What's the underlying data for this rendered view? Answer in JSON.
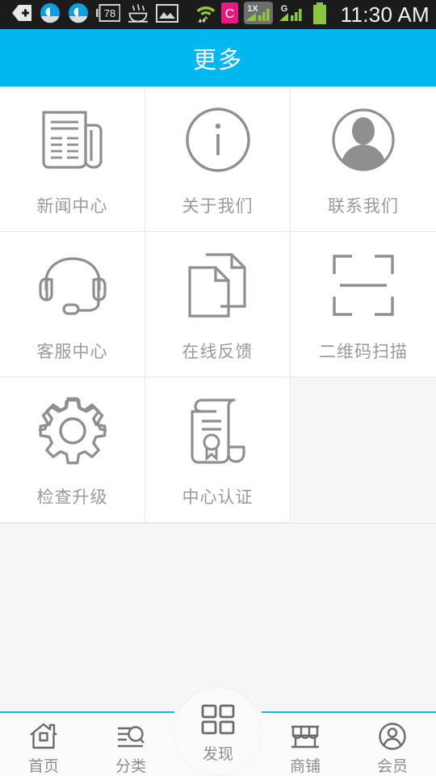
{
  "statusbar": {
    "time": "11:30 AM",
    "left_icons": [
      {
        "name": "back-plus-icon",
        "label": "back-plus"
      },
      {
        "name": "cloud-sync-icon",
        "label": "cloud-sync"
      },
      {
        "name": "cloud-sync-icon-2",
        "label": "cloud-sync"
      },
      {
        "name": "battery-percent-badge-icon",
        "label": "78"
      },
      {
        "name": "steam-bowl-icon",
        "label": "steam-bowl"
      },
      {
        "name": "image-icon",
        "label": "image"
      }
    ],
    "right_icons": [
      {
        "name": "wifi-icon",
        "label": "wifi"
      },
      {
        "name": "c-app-icon",
        "label": "C"
      },
      {
        "name": "signal-1x-icon",
        "label": "1X"
      },
      {
        "name": "signal-g-icon",
        "label": "G"
      },
      {
        "name": "battery-icon",
        "label": "battery"
      }
    ],
    "badge_value": "78",
    "c_badge_letter": "C",
    "onex_label": "1X",
    "g_label": "G",
    "colors": {
      "bg": "#1b1b1b",
      "text": "#f2f2f2",
      "signal_green": "#8cc63e",
      "c_pink": "#e5197f",
      "cloud_blue": "#0b9fe0"
    }
  },
  "header": {
    "title": "更多",
    "bg": "#00b7f0",
    "text_color": "#ffffff"
  },
  "grid": {
    "items": [
      {
        "label": "新闻中心",
        "icon": "newspaper-icon"
      },
      {
        "label": "关于我们",
        "icon": "info-circle-icon"
      },
      {
        "label": "联系我们",
        "icon": "person-avatar-icon"
      },
      {
        "label": "客服中心",
        "icon": "headset-icon"
      },
      {
        "label": "在线反馈",
        "icon": "documents-icon"
      },
      {
        "label": "二维码扫描",
        "icon": "qr-scan-icon"
      },
      {
        "label": "检查升级",
        "icon": "gear-icon"
      },
      {
        "label": "中心认证",
        "icon": "certificate-scroll-icon"
      }
    ],
    "icon_color": "#8f8f8f",
    "label_color": "#9a9a9a",
    "cell_bg": "#ffffff",
    "divider": "#e8e8e8"
  },
  "tabbar": {
    "items": [
      {
        "label": "首页",
        "icon": "home-icon",
        "active": false
      },
      {
        "label": "分类",
        "icon": "category-search-icon",
        "active": false
      },
      {
        "label": "发现",
        "icon": "grid-squares-icon",
        "active": true
      },
      {
        "label": "商铺",
        "icon": "shop-icon",
        "active": false
      },
      {
        "label": "会员",
        "icon": "member-user-icon",
        "active": false
      }
    ],
    "accent": "#16b4f0",
    "label_color": "#8d8d8d",
    "icon_color": "#6b6b6b",
    "bg": "#fbfbfb"
  },
  "page": {
    "background": "#f6f6f6"
  }
}
